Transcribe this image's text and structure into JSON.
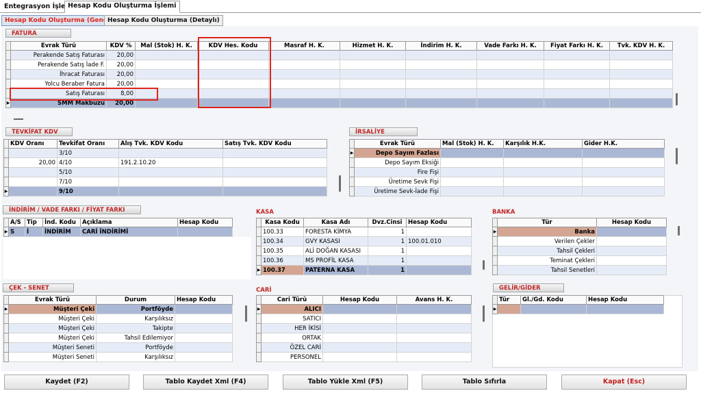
{
  "top_tabs": [
    "Entegrasyon İşlemi",
    "Hesap Kodu Oluşturma İşlemi"
  ],
  "sub_tabs": [
    "Hesap Kodu Oluşturma (Genel)",
    "Hesap Kodu Oluşturma (Detaylı)"
  ],
  "fatura": {
    "title": "FATURA",
    "headers": [
      "Evrak Türü",
      "KDV %",
      "Mal (Stok) H. K.",
      "KDV Hes. Kodu",
      "Masraf H. K.",
      "Hizmet H. K.",
      "İndirim H. K.",
      "Vade Farkı H. K.",
      "Fiyat Farkı H. K.",
      "Tvk. KDV H. K."
    ],
    "rows": [
      {
        "type": "Perakende Satış Faturası",
        "kdv": "20,00"
      },
      {
        "type": "Perakende Satış İade F.",
        "kdv": "20,00"
      },
      {
        "type": "İhracat Faturası",
        "kdv": "20,00"
      },
      {
        "type": "Yolcu Beraber Fatura",
        "kdv": "20,00"
      },
      {
        "type": "Satış Faturası",
        "kdv": "8,00"
      },
      {
        "type": "SMM Makbuzu",
        "kdv": "20,00"
      }
    ]
  },
  "tevkifat": {
    "title": "TEVKİFAT KDV",
    "headers": [
      "KDV Oranı",
      "Tevkifat Oranı",
      "Alış Tvk. KDV Kodu",
      "Satış Tvk. KDV Kodu"
    ],
    "rows": [
      {
        "kdv": "",
        "tevkifat": "3/10",
        "alis": "",
        "satis": ""
      },
      {
        "kdv": "20,00",
        "tevkifat": "4/10",
        "alis": "191.2.10.20",
        "satis": ""
      },
      {
        "kdv": "",
        "tevkifat": "5/10",
        "alis": "",
        "satis": ""
      },
      {
        "kdv": "",
        "tevkifat": "7/10",
        "alis": "",
        "satis": ""
      },
      {
        "kdv": "",
        "tevkifat": "9/10",
        "alis": "",
        "satis": ""
      }
    ]
  },
  "irsaliye": {
    "title": "İRSALİYE",
    "headers": [
      "Evrak Türü",
      "Mal (Stok) H. K.",
      "Karşılık H.K.",
      "Gider H.K."
    ],
    "rows": [
      "Depo Sayım Fazlası",
      "Depo Sayım Eksiği",
      "Fire Fişi",
      "Üretime Sevk Fişi",
      "Üretime Sevk-İade Fişi"
    ]
  },
  "indirim": {
    "title": "İNDİRİM / VADE FARKI / FİYAT FARKI",
    "headers": [
      "A/S",
      "Tip",
      "İnd. Kodu",
      "Açıklama",
      "Hesap Kodu"
    ],
    "rows": [
      {
        "as": "S",
        "tip": "İ",
        "kod": "İNDİRİM",
        "aciklama": "CARİ İNDİRİMİ",
        "hesap": ""
      }
    ]
  },
  "kasa": {
    "title": "KASA",
    "headers": [
      "Kasa Kodu",
      "Kasa Adı",
      "Dvz.Cinsi",
      "Hesap Kodu"
    ],
    "rows": [
      {
        "kod": "100.33",
        "ad": "FORESTA KİMYA",
        "dvz": "1",
        "hesap": ""
      },
      {
        "kod": "100.34",
        "ad": "GVY KASASI",
        "dvz": "1",
        "hesap": "100.01.010"
      },
      {
        "kod": "100.35",
        "ad": "ALİ DOĞAN KASASI",
        "dvz": "1",
        "hesap": ""
      },
      {
        "kod": "100.36",
        "ad": "MS PROFİL KASA",
        "dvz": "1",
        "hesap": ""
      },
      {
        "kod": "100.37",
        "ad": "PATERNA KASA",
        "dvz": "1",
        "hesap": ""
      }
    ]
  },
  "banka": {
    "title": "BANKA",
    "headers": [
      "Tür",
      "Hesap Kodu"
    ],
    "rows": [
      "Banka",
      "Verilen Çekler",
      "Tahsil Çekleri",
      "Teminat Çekleri",
      "Tahsil Senetleri"
    ]
  },
  "cek": {
    "title": "ÇEK - SENET",
    "headers": [
      "Evrak Türü",
      "Durum",
      "Hesap Kodu"
    ],
    "rows": [
      {
        "tur": "Müşteri Çeki",
        "durum": "Portföyde"
      },
      {
        "tur": "Müşteri Çeki",
        "durum": "Karşılıksız"
      },
      {
        "tur": "Müşteri Çeki",
        "durum": "Takipte"
      },
      {
        "tur": "Müşteri Çeki",
        "durum": "Tahsil Edilemiyor"
      },
      {
        "tur": "Müşteri Seneti",
        "durum": "Portföyde"
      },
      {
        "tur": "Müşteri Seneti",
        "durum": "Karşılıksız"
      }
    ]
  },
  "cari": {
    "title": "CARİ",
    "headers": [
      "Cari Türü",
      "Hesap Kodu",
      "Avans H. K."
    ],
    "rows": [
      "ALICI",
      "SATICI",
      "HER İKİSİ",
      "ORTAK",
      "ÖZEL CARİ",
      "PERSONEL"
    ]
  },
  "gelir": {
    "title": "GELİR/GİDER",
    "headers": [
      "Tür",
      "Gl./Gd. Kodu",
      "Hesap Kodu"
    ]
  },
  "buttons": {
    "save": "Kaydet (F2)",
    "save_xml": "Tablo Kaydet Xml (F4)",
    "load_xml": "Tablo Yükle Xml (F5)",
    "reset": "Tablo Sıfırla",
    "close": "Kapat (Esc)"
  },
  "colors": {
    "accent_red": "#e0241b",
    "selected_row": "#aab8d6",
    "selected_brown": "#d3a592"
  }
}
